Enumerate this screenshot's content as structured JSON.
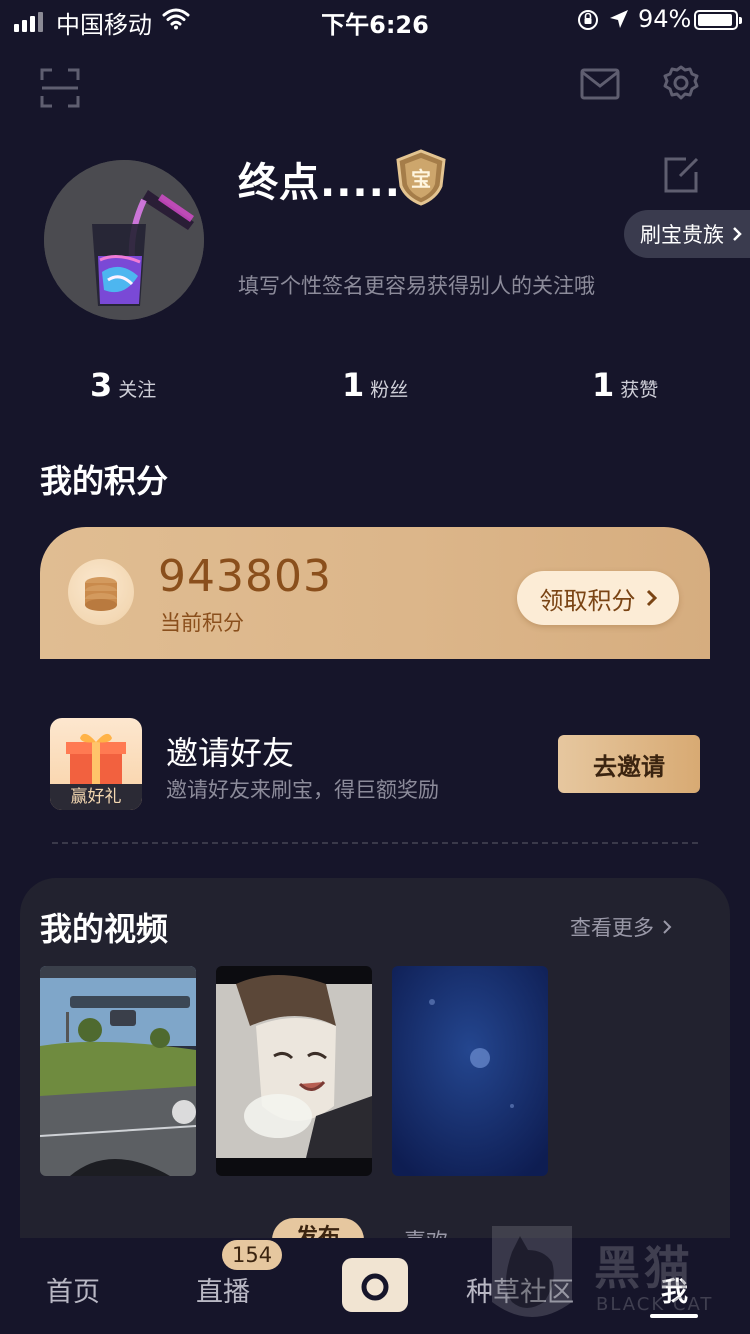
{
  "status": {
    "carrier": "中国移动",
    "time": "下午6:26",
    "battery": "94%",
    "battery_level": 0.94
  },
  "top_icons": [
    "scan-icon",
    "mail-icon",
    "gear-icon"
  ],
  "profile": {
    "name": "终点.....",
    "badge_char": "宝",
    "vip_label": "刷宝贵族",
    "signature": "填写个性签名更容易获得别人的关注哦"
  },
  "stats": [
    {
      "num": "3",
      "label": "关注"
    },
    {
      "num": "1",
      "label": "粉丝"
    },
    {
      "num": "1",
      "label": "获赞"
    }
  ],
  "points": {
    "section_title": "我的积分",
    "value": "943803",
    "label": "当前积分",
    "claim_label": "领取积分"
  },
  "invite": {
    "gift_label": "赢好礼",
    "title": "邀请好友",
    "desc": "邀请好友来刷宝，得巨额奖励",
    "button": "去邀请"
  },
  "videos": {
    "title": "我的视频",
    "more": "查看更多",
    "tabs": [
      "发布",
      "喜欢"
    ]
  },
  "tabbar": {
    "items": [
      "首页",
      "直播",
      "种草社区",
      "我"
    ],
    "live_count": "154",
    "active": "我"
  },
  "watermark": {
    "text": "黑猫",
    "sub": "BLACK CAT"
  },
  "colors": {
    "background": "#16152a",
    "gold": "#e6c79f",
    "points_text": "#8a4f1c"
  }
}
